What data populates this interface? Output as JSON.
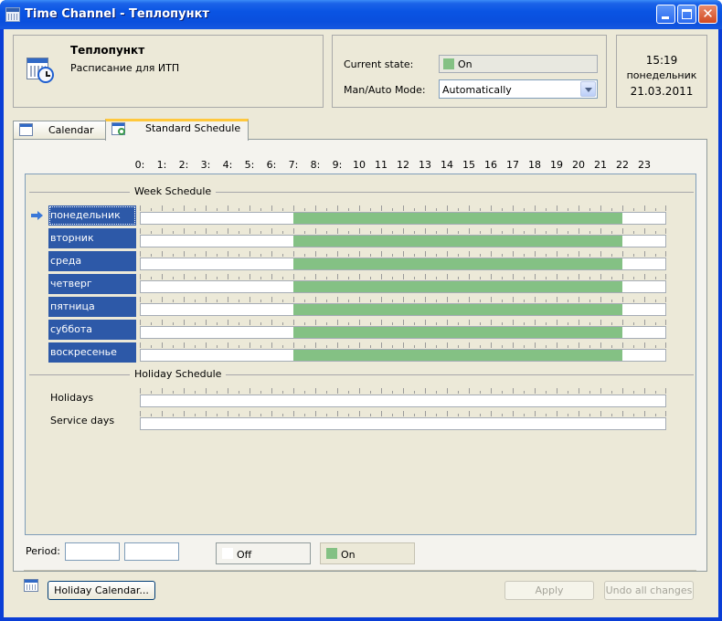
{
  "window": {
    "title": "Time Channel - Теплопункт",
    "controls": {
      "minimize": "minimize-icon",
      "maximize": "maximize-icon",
      "close": "close-icon"
    }
  },
  "header": {
    "name": "Теплопункт",
    "subtitle": "Расписание для ИТП",
    "icon": "calendar-clock-icon"
  },
  "status": {
    "current_state_label": "Current state:",
    "current_state_value": "On",
    "mode_label": "Man/Auto Mode:",
    "mode_value": "Automatically"
  },
  "clock": {
    "time": "15:19",
    "weekday": "понедельник",
    "date": "21.03.2011"
  },
  "tabs": [
    {
      "label": "Calendar",
      "icon": "calendar-icon",
      "active": false
    },
    {
      "label": "Standard Schedule",
      "icon": "schedule-icon",
      "active": true
    }
  ],
  "hours": [
    "0:",
    "1:",
    "2:",
    "3:",
    "4:",
    "5:",
    "6:",
    "7:",
    "8:",
    "9:",
    "10",
    "11",
    "12",
    "13",
    "14",
    "15",
    "16",
    "17",
    "18",
    "19",
    "20",
    "21",
    "22",
    "23"
  ],
  "week_schedule": {
    "title": "Week Schedule",
    "rows": [
      {
        "day": "понедельник",
        "current": true,
        "on_start_hour": 7,
        "on_end_hour": 22
      },
      {
        "day": "вторник",
        "current": false,
        "on_start_hour": 7,
        "on_end_hour": 22
      },
      {
        "day": "среда",
        "current": false,
        "on_start_hour": 7,
        "on_end_hour": 22
      },
      {
        "day": "четверг",
        "current": false,
        "on_start_hour": 7,
        "on_end_hour": 22
      },
      {
        "day": "пятница",
        "current": false,
        "on_start_hour": 7,
        "on_end_hour": 22
      },
      {
        "day": "суббота",
        "current": false,
        "on_start_hour": 7,
        "on_end_hour": 22
      },
      {
        "day": "воскресенье",
        "current": false,
        "on_start_hour": 7,
        "on_end_hour": 22
      }
    ]
  },
  "holiday_schedule": {
    "title": "Holiday Schedule",
    "rows": [
      {
        "label": "Holidays"
      },
      {
        "label": "Service days"
      }
    ]
  },
  "footer": {
    "period_label": "Period:",
    "period_from": "",
    "period_to": "",
    "legend_off": "Off",
    "legend_on": "On",
    "holiday_calendar_button": "Holiday Calendar...",
    "apply_button": "Apply",
    "undo_button": "Undo all changes"
  },
  "colors": {
    "on": "#84c184",
    "off": "#ffffff",
    "day_label_bg": "#2d59a8",
    "title_bar": "#0a54e3"
  }
}
